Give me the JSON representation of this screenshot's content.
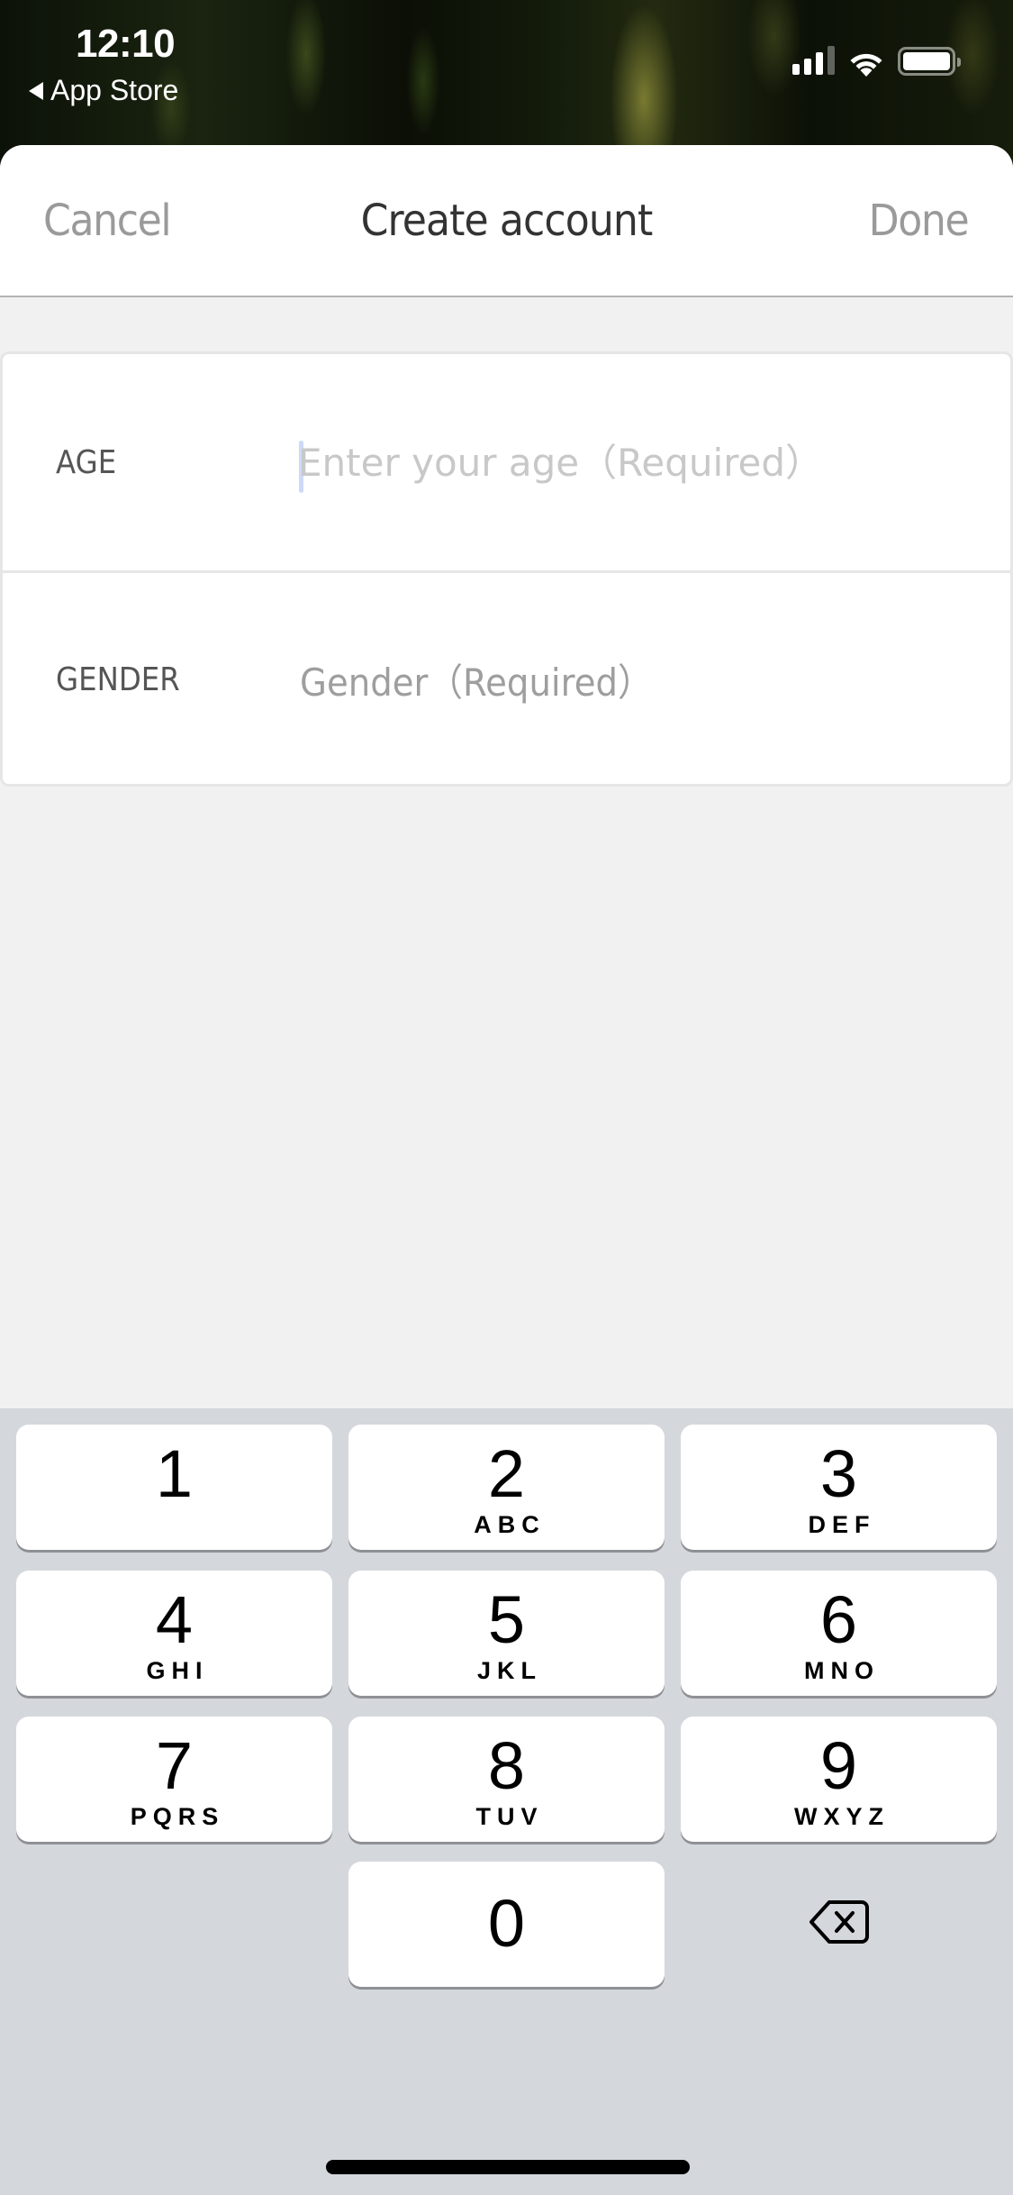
{
  "status_bar": {
    "time": "12:10",
    "back_label": "App Store",
    "signal_bars_active": 3,
    "signal_bars_total": 4,
    "battery_level": 0.95,
    "icons": [
      "signal-icon",
      "wifi-icon",
      "battery-icon"
    ]
  },
  "nav": {
    "cancel_label": "Cancel",
    "title": "Create account",
    "done_label": "Done"
  },
  "form": {
    "fields": [
      {
        "label": "AGE",
        "value": "",
        "placeholder": "Enter your age（Required）",
        "focused": true
      },
      {
        "label": "GENDER",
        "value": "",
        "placeholder": "Gender（Required）"
      }
    ]
  },
  "keyboard": {
    "keys": [
      {
        "digit": "1",
        "letters": ""
      },
      {
        "digit": "2",
        "letters": "ABC"
      },
      {
        "digit": "3",
        "letters": "DEF"
      },
      {
        "digit": "4",
        "letters": "GHI"
      },
      {
        "digit": "5",
        "letters": "JKL"
      },
      {
        "digit": "6",
        "letters": "MNO"
      },
      {
        "digit": "7",
        "letters": "PQRS"
      },
      {
        "digit": "8",
        "letters": "TUV"
      },
      {
        "digit": "9",
        "letters": "WXYZ"
      },
      {
        "digit": "0",
        "letters": ""
      }
    ],
    "delete_icon": "backspace-icon"
  },
  "colors": {
    "nav_inactive": "#9a9a9a",
    "title": "#333333",
    "placeholder_age": "#c8c8c8",
    "placeholder_gender": "#9e9e9e",
    "caret": "#cdd9f8",
    "keyboard_bg": "#d4d7dc"
  }
}
